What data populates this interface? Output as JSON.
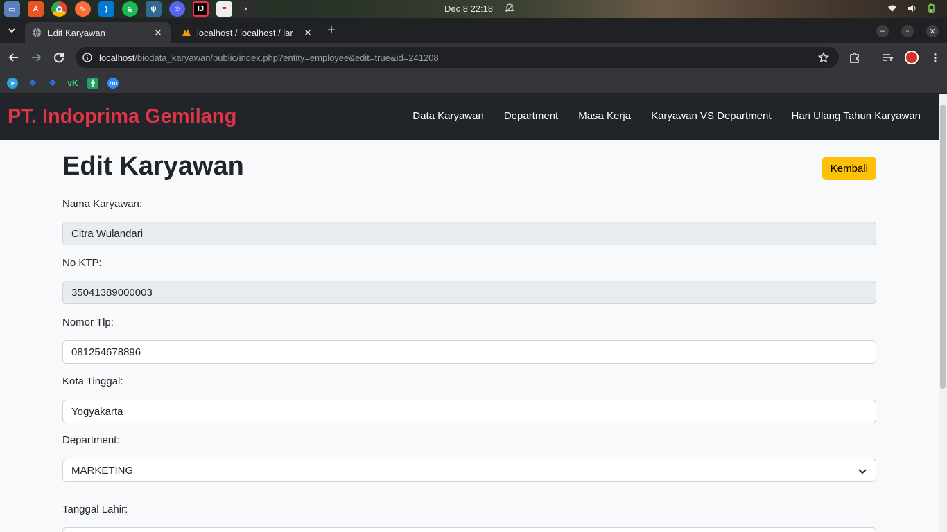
{
  "os": {
    "clock": "Dec 8  22:18",
    "apps": [
      "files-app",
      "app-store-app",
      "chrome-app",
      "postman-app",
      "vscode-app",
      "spotify-app",
      "pgadmin-app",
      "discord-app",
      "intellij-app",
      "notes-app",
      "terminal-app"
    ]
  },
  "browser": {
    "tabs": [
      {
        "title": "Edit Karyawan",
        "active": true
      },
      {
        "title": "localhost / localhost / lar",
        "active": false
      }
    ],
    "url_host": "localhost",
    "url_path": "/biodata_karyawan/public/index.php?entity=employee&edit=true&id=241208",
    "bookmark_labels": [
      "telegram",
      "jira",
      "jira2",
      "vk",
      "sheets",
      "zm"
    ]
  },
  "navbar": {
    "brand": "PT. Indoprima Gemilang",
    "links": [
      "Data Karyawan",
      "Department",
      "Masa Kerja",
      "Karyawan VS Department",
      "Hari Ulang Tahun Karyawan"
    ]
  },
  "form": {
    "title": "Edit Karyawan",
    "back_button": "Kembali",
    "nama_label": "Nama Karyawan:",
    "nama_value": "Citra Wulandari",
    "ktp_label": "No KTP:",
    "ktp_value": "35041389000003",
    "tlp_label": "Nomor Tlp:",
    "tlp_value": "081254678896",
    "kota_label": "Kota Tinggal:",
    "kota_value": "Yogyakarta",
    "dept_label": "Department:",
    "dept_value": "MARKETING",
    "lahir_label": "Tanggal Lahir:"
  },
  "colors": {
    "brand": "#dc3545",
    "navbar_bg": "#212529",
    "back_button_bg": "#ffc107"
  }
}
